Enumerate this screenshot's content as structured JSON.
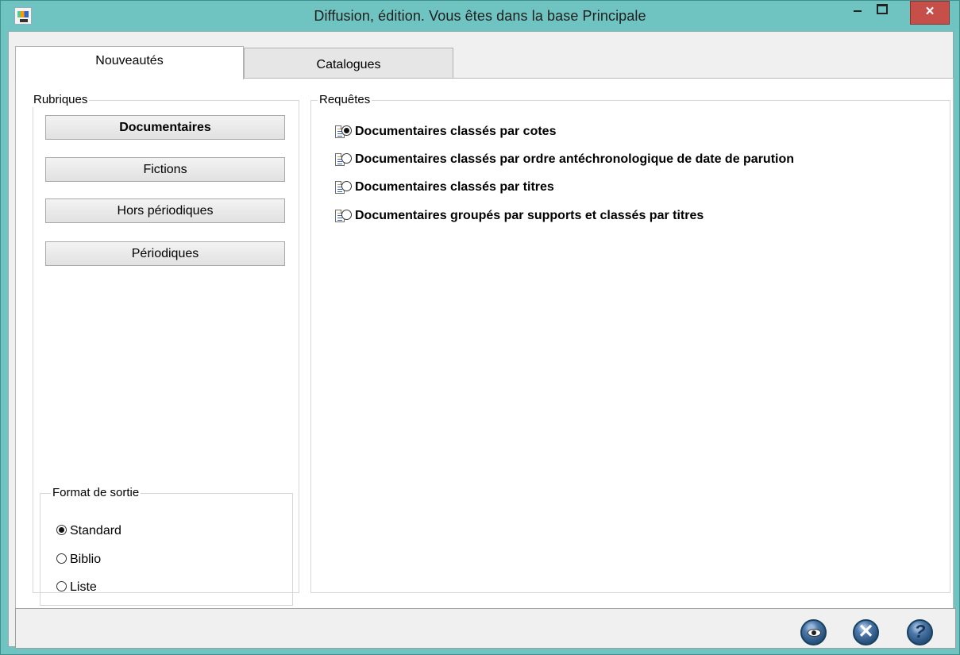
{
  "window": {
    "title": "Diffusion, édition.  Vous êtes dans la base Principale",
    "minimize_symbol": "–",
    "maximize_symbol": "□",
    "close_symbol": "×"
  },
  "tabs": [
    {
      "label": "Nouveautés"
    },
    {
      "label": "Catalogues"
    }
  ],
  "rubriques": {
    "label": "Rubriques",
    "buttons": [
      {
        "label": "Documentaires"
      },
      {
        "label": "Fictions"
      },
      {
        "label": "Hors périodiques"
      },
      {
        "label": "Périodiques"
      }
    ]
  },
  "format": {
    "label": "Format de sortie",
    "options": [
      {
        "label": "Standard",
        "selected": true
      },
      {
        "label": "Biblio",
        "selected": false
      },
      {
        "label": "Liste",
        "selected": false
      }
    ]
  },
  "requetes": {
    "label": "Requêtes",
    "items": [
      {
        "label": "Documentaires classés par cotes",
        "selected": true
      },
      {
        "label": "Documentaires classés par ordre antéchronologique de date de parution",
        "selected": false
      },
      {
        "label": "Documentaires classés par titres",
        "selected": false
      },
      {
        "label": "Documentaires groupés par supports et classés par titres",
        "selected": false
      }
    ]
  },
  "actions": [
    {
      "icon": "eye-icon"
    },
    {
      "icon": "cancel-icon"
    },
    {
      "icon": "help-icon"
    }
  ]
}
